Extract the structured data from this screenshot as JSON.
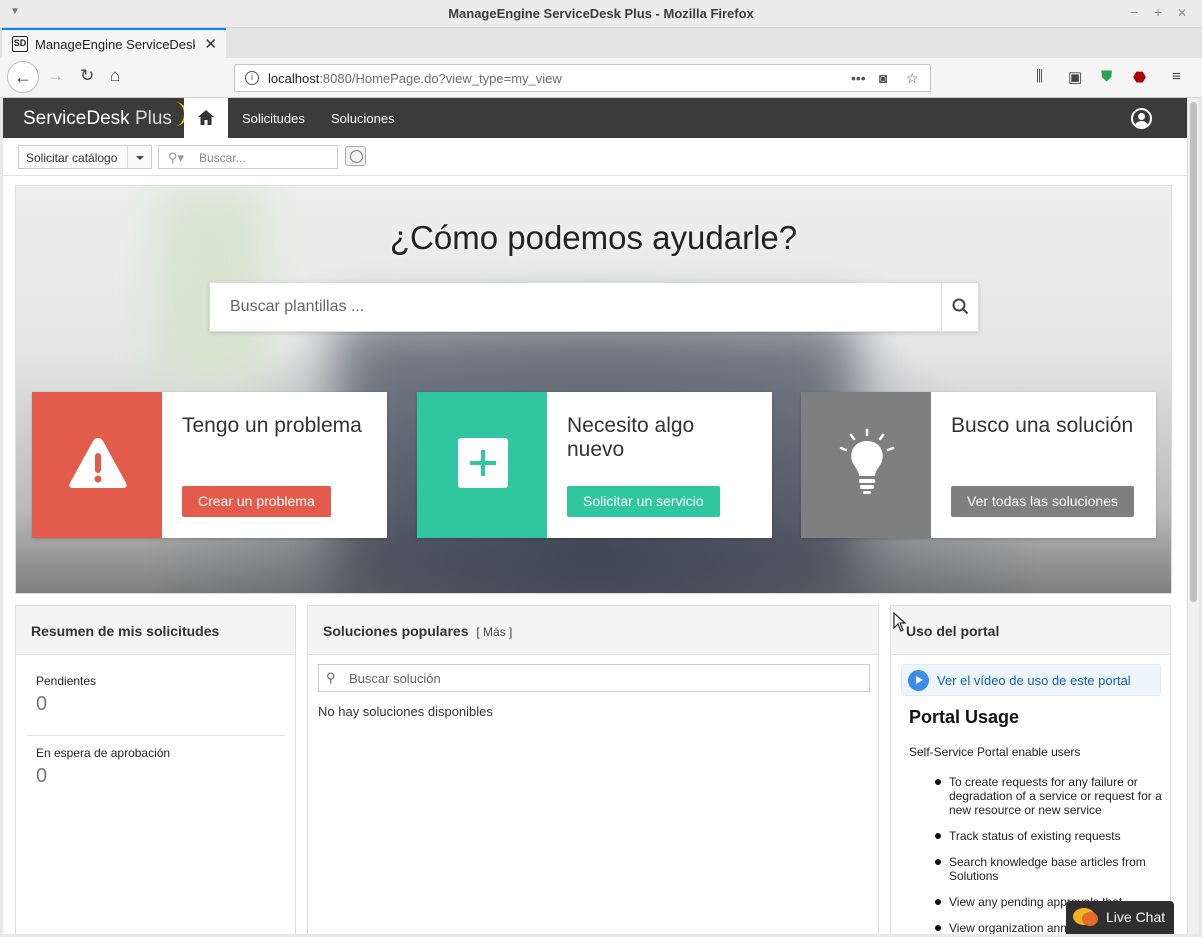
{
  "window": {
    "title": "ManageEngine ServiceDesk Plus - Mozilla Firefox",
    "min_glyph": "−",
    "max_glyph": "+",
    "close_glyph": "✕"
  },
  "browser": {
    "tab_title": "ManageEngine ServiceDesk Plus",
    "favicon_text": "SD",
    "url_host": "localhost",
    "url_rest": ":8080/HomePage.do?view_type=my_view",
    "icons": [
      "back-icon",
      "forward-icon",
      "reload-icon",
      "home-icon",
      "page-actions-icon",
      "pocket-icon",
      "bookmark-star-icon",
      "library-icon",
      "sidebar-icon",
      "shield-extension-icon",
      "ublock-icon",
      "menu-icon"
    ]
  },
  "app": {
    "logo_main": "ServiceDesk",
    "logo_plus": "Plus",
    "nav": [
      "Solicitudes",
      "Soluciones"
    ],
    "catalog_label": "Solicitar catálogo",
    "search_placeholder": "Buscar..."
  },
  "hero": {
    "title": "¿Cómo podemos ayudarle?",
    "search_placeholder": "Buscar plantillas ...",
    "cards": [
      {
        "title": "Tengo un problema",
        "button": "Crear un problema",
        "color": "#e35b4a",
        "icon": "warning-icon"
      },
      {
        "title": "Necesito algo nuevo",
        "button": "Solicitar un servicio",
        "color": "#2fc6a0",
        "icon": "plus-icon"
      },
      {
        "title": "Busco una solución",
        "button": "Ver todas las soluciones",
        "color": "#7f7f7f",
        "icon": "lightbulb-icon"
      }
    ]
  },
  "summary": {
    "title": "Resumen de mis solicitudes",
    "pending_label": "Pendientes",
    "pending_value": "0",
    "approval_label": "En espera de aprobación",
    "approval_value": "0"
  },
  "solutions": {
    "title": "Soluciones populares",
    "more": "[ Más ]",
    "search_placeholder": "Buscar solución",
    "empty": "No hay soluciones disponibles"
  },
  "portal": {
    "title": "Uso del portal",
    "video_link": "Ver el vídeo de uso de este portal",
    "heading": "Portal Usage",
    "intro": "Self-Service Portal enable users",
    "items": [
      "To create requests for any failure or degradation of a service or request for a new resource or new service",
      "Track status of existing requests",
      "Search knowledge base articles from Solutions",
      "View any pending approvals that",
      "View organization ann"
    ]
  },
  "livechat": {
    "label": "Live Chat"
  }
}
